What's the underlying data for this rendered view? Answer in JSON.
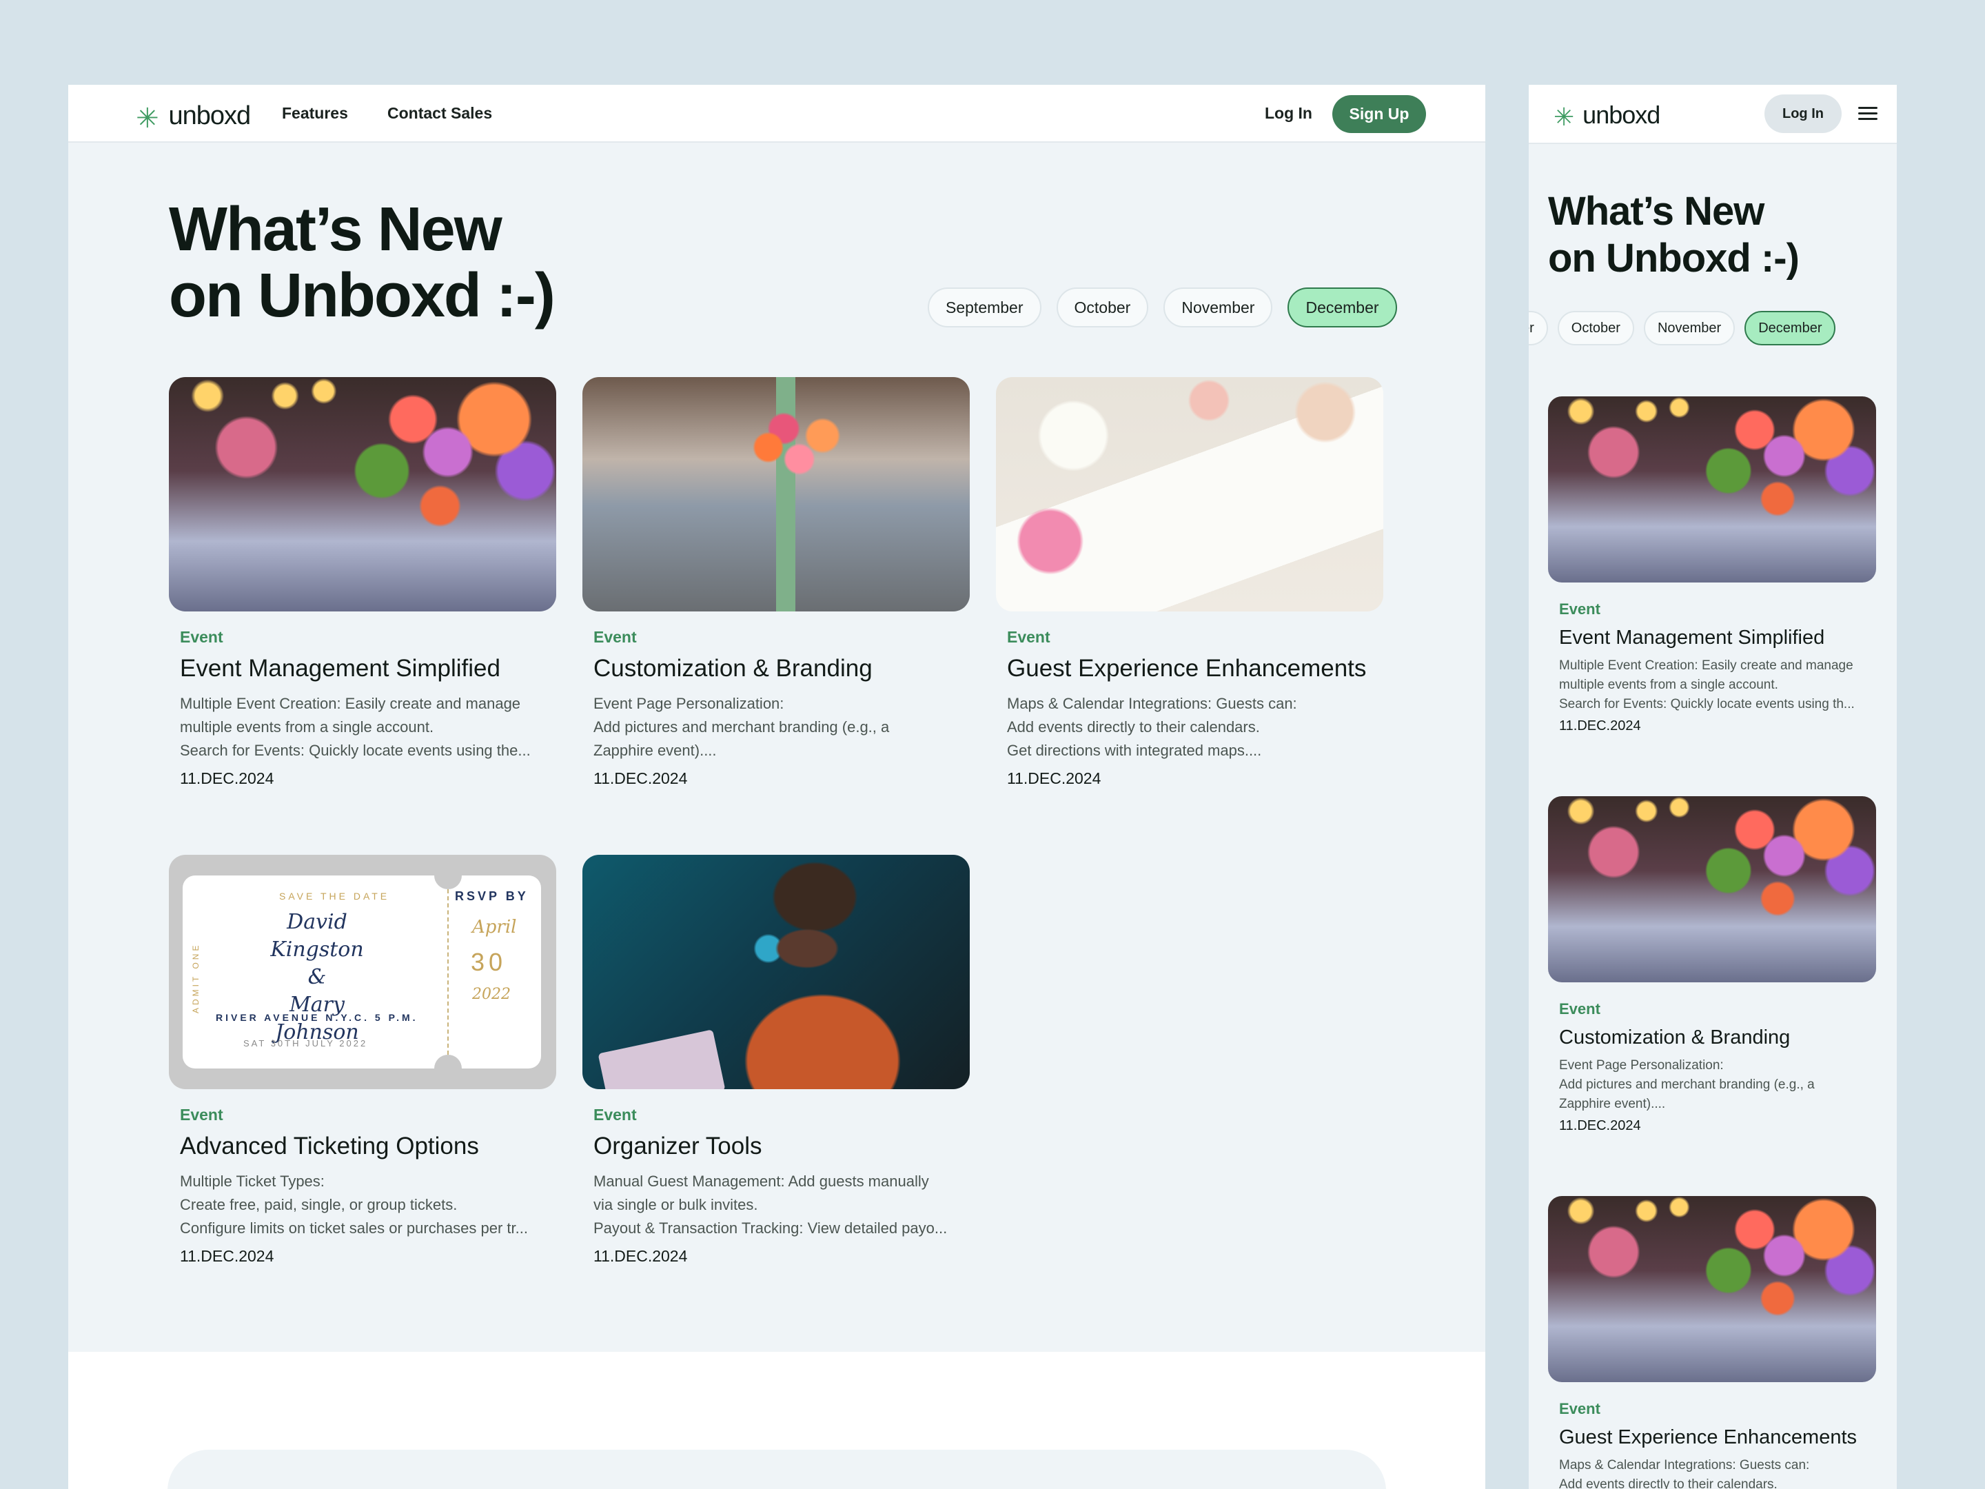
{
  "brand": {
    "name": "unboxd",
    "star": "✳",
    "accent": "#3e7f58",
    "active_pill": "#a7ecc0"
  },
  "nav": {
    "features": "Features",
    "contact_sales": "Contact Sales",
    "login": "Log In",
    "signup": "Sign Up"
  },
  "hero": {
    "title": "What’s New\non Unboxd :-)"
  },
  "months": [
    "September",
    "October",
    "November",
    "December"
  ],
  "mobile_months": [
    "er",
    "October",
    "November",
    "December"
  ],
  "active_month": "December",
  "cards": [
    {
      "tag": "Event",
      "title": "Event Management Simplified",
      "body": [
        "Multiple Event Creation: Easily create and manage",
        "multiple events from a single account.",
        "Search for Events: Quickly locate events using the..."
      ],
      "date": "11.DEC.2024",
      "image": "flowers-table"
    },
    {
      "tag": "Event",
      "title": "Customization & Branding",
      "body": [
        "Event Page Personalization:",
        "Add pictures and merchant branding (e.g., a",
        "Zapphire event)...."
      ],
      "date": "11.DEC.2024",
      "image": "vase-meeting-room"
    },
    {
      "tag": "Event",
      "title": "Guest Experience Enhancements",
      "body": [
        "Maps & Calendar Integrations: Guests can:",
        "Add events directly to their calendars.",
        "Get directions with integrated maps...."
      ],
      "date": "11.DEC.2024",
      "image": "notebook-flowers"
    },
    {
      "tag": "Event",
      "title": "Advanced Ticketing Options",
      "body": [
        "Multiple Ticket Types:",
        "Create free, paid, single, or group tickets.",
        "Configure limits on ticket sales or purchases per tr..."
      ],
      "date": "11.DEC.2024",
      "image": "ticket",
      "ticket": {
        "save": "SAVE THE DATE",
        "names": [
          "David Kingston",
          "&",
          "Mary Johnson"
        ],
        "rsvp": "RSVP BY",
        "month": "April",
        "day": "30",
        "year": "2022",
        "address": "RIVER AVENUE N.Y.C.   5 P.M.",
        "date_line": "SAT 30TH JULY      2022",
        "admit": "ADMIT ONE"
      }
    },
    {
      "tag": "Event",
      "title": "Organizer Tools",
      "body": [
        "Manual Guest Management: Add guests manually",
        "via single or bulk invites.",
        "Payout & Transaction Tracking: View detailed payo..."
      ],
      "date": "11.DEC.2024",
      "image": "person-headphones"
    }
  ],
  "mobile_cards": [
    {
      "tag": "Event",
      "title": "Event Management Simplified",
      "body": [
        "Multiple Event Creation: Easily create and manage",
        "multiple events from a single account.",
        "Search for Events: Quickly locate events using th..."
      ],
      "date": "11.DEC.2024"
    },
    {
      "tag": "Event",
      "title": "Customization & Branding",
      "body": [
        "Event Page Personalization:",
        "Add pictures and merchant branding (e.g., a",
        "Zapphire event)...."
      ],
      "date": "11.DEC.2024"
    },
    {
      "tag": "Event",
      "title": "Guest Experience Enhancements",
      "body": [
        "Maps & Calendar Integrations: Guests can:",
        "Add events directly to their calendars."
      ],
      "date": ""
    }
  ]
}
